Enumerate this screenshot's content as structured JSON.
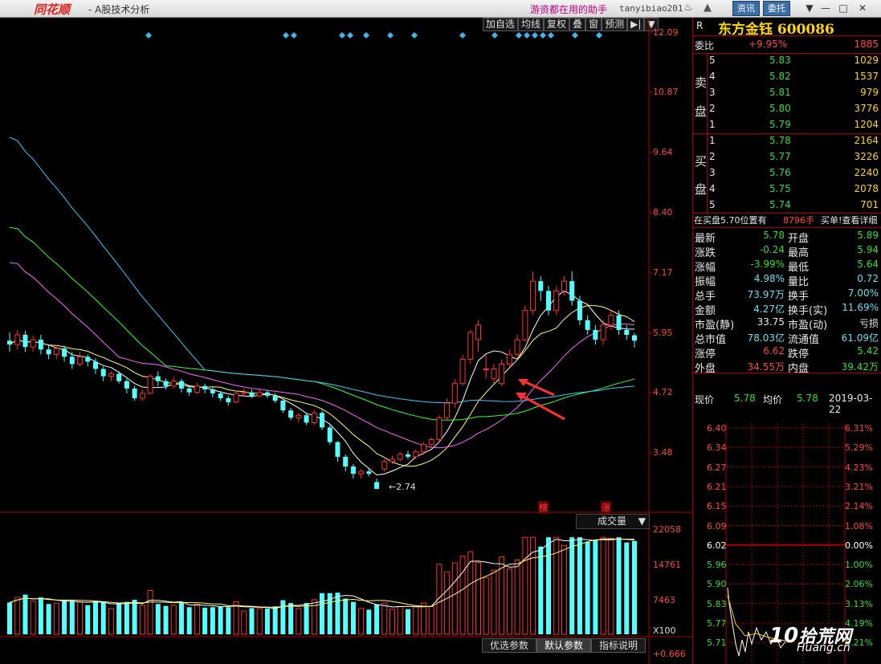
{
  "titlebar": {
    "logo": "同花顺",
    "title": "- A股技术分析",
    "slogan": "游资都在用的助手",
    "user": "tanyibiao201",
    "btn_news": "资讯",
    "btn_order": "委托"
  },
  "toolbar": [
    "加自选",
    "均线",
    "复权",
    "叠",
    "窗",
    "预测"
  ],
  "stock": {
    "r": "R",
    "name": "东方金钰 600086"
  },
  "weibi": {
    "label": "委比",
    "pct": "+9.95%",
    "val": "1885"
  },
  "sell_label": [
    "卖",
    "盘"
  ],
  "buy_label": [
    "买",
    "盘"
  ],
  "sell": [
    {
      "lv": "5",
      "p": "5.83",
      "v": "1029"
    },
    {
      "lv": "4",
      "p": "5.82",
      "v": "1537"
    },
    {
      "lv": "3",
      "p": "5.81",
      "v": "979"
    },
    {
      "lv": "2",
      "p": "5.80",
      "v": "3776"
    },
    {
      "lv": "1",
      "p": "5.79",
      "v": "1204"
    }
  ],
  "buy": [
    {
      "lv": "1",
      "p": "5.78",
      "v": "2164"
    },
    {
      "lv": "2",
      "p": "5.77",
      "v": "3226"
    },
    {
      "lv": "3",
      "p": "5.76",
      "v": "2240"
    },
    {
      "lv": "4",
      "p": "5.75",
      "v": "2078"
    },
    {
      "lv": "5",
      "p": "5.74",
      "v": "701"
    }
  ],
  "maibuy": {
    "a": "在买盘5.70位置有",
    "b": "8796手",
    "c": "买单!查看详细"
  },
  "quote": [
    {
      "l1": "最新",
      "v1": "5.78",
      "c1": "green",
      "l2": "开盘",
      "v2": "5.89",
      "c2": "green"
    },
    {
      "l1": "涨跌",
      "v1": "-0.24",
      "c1": "green",
      "l2": "最高",
      "v2": "5.94",
      "c2": "green"
    },
    {
      "l1": "涨幅",
      "v1": "-3.99%",
      "c1": "green",
      "l2": "最低",
      "v2": "5.64",
      "c2": "green"
    },
    {
      "l1": "振幅",
      "v1": "4.98%",
      "c1": "cyan",
      "l2": "量比",
      "v2": "0.72",
      "c2": "cyan"
    },
    {
      "l1": "总手",
      "v1": "73.97万",
      "c1": "cyan",
      "l2": "换手",
      "v2": "7.00%",
      "c2": "cyan"
    },
    {
      "l1": "金额",
      "v1": "4.27亿",
      "c1": "cyan",
      "l2": "换手(实)",
      "v2": "11.69%",
      "c2": "cyan"
    },
    {
      "l1": "市盈(静)",
      "v1": "33.75",
      "c1": "white",
      "l2": "市盈(动)",
      "v2": "亏损",
      "c2": "white"
    },
    {
      "l1": "总市值",
      "v1": "78.03亿",
      "c1": "cyan",
      "l2": "流通值",
      "v2": "61.09亿",
      "c2": "cyan"
    },
    {
      "l1": "涨停",
      "v1": "6.62",
      "c1": "red",
      "l2": "跌停",
      "v2": "5.42",
      "c2": "green"
    },
    {
      "l1": "外盘",
      "v1": "34.55万",
      "c1": "red",
      "l2": "内盘",
      "v2": "39.42万",
      "c2": "green"
    }
  ],
  "current": {
    "l1": "现价",
    "v1": "5.78",
    "l2": "均价",
    "v2": "5.78",
    "date": "2019-03-22"
  },
  "kline_axis": [
    "12.09",
    "10.87",
    "9.64",
    "8.40",
    "7.17",
    "5.95",
    "4.72",
    "3.48"
  ],
  "low_label": "2.74",
  "tags": {
    "bang": "榜",
    "zhang": "涨"
  },
  "vol": {
    "tag": "成交量",
    "axis": [
      "22058",
      "14761",
      "7463"
    ],
    "unit": "X100"
  },
  "macd_val": "+0.666",
  "bottom_tabs": [
    "优选参数",
    "默认参数",
    "指标说明"
  ],
  "intraday_axis": [
    {
      "p": "6.40",
      "pc": "6.31%"
    },
    {
      "p": "6.34",
      "pc": "5.29%"
    },
    {
      "p": "6.27",
      "pc": "4.23%"
    },
    {
      "p": "6.21",
      "pc": "3.21%"
    },
    {
      "p": "6.15",
      "pc": "2.14%"
    },
    {
      "p": "6.09",
      "pc": "1.08%"
    },
    {
      "p": "6.02",
      "pc": "0.00%"
    },
    {
      "p": "5.96",
      "pc": "1.00%"
    },
    {
      "p": "5.90",
      "pc": "2.06%"
    },
    {
      "p": "5.83",
      "pc": "3.13%"
    },
    {
      "p": "5.77",
      "pc": "4.19%"
    },
    {
      "p": "5.71",
      "pc": "5.21%"
    }
  ],
  "watermark": {
    "a": "10",
    "b": "拾荒网",
    "c": "Huang.cn"
  },
  "chart_data": {
    "type": "candlestick",
    "price_range": [
      2.74,
      12.09
    ],
    "low": 2.74,
    "candles": [
      [
        5.78,
        5.7,
        5.95,
        5.55
      ],
      [
        5.7,
        5.9,
        6.0,
        5.6
      ],
      [
        5.9,
        5.65,
        5.98,
        5.55
      ],
      [
        5.65,
        5.8,
        5.88,
        5.55
      ],
      [
        5.8,
        5.6,
        5.9,
        5.5
      ],
      [
        5.6,
        5.5,
        5.7,
        5.4
      ],
      [
        5.5,
        5.62,
        5.7,
        5.4
      ],
      [
        5.62,
        5.45,
        5.68,
        5.35
      ],
      [
        5.45,
        5.3,
        5.55,
        5.2
      ],
      [
        5.3,
        5.45,
        5.55,
        5.25
      ],
      [
        5.45,
        5.35,
        5.5,
        5.25
      ],
      [
        5.35,
        5.2,
        5.42,
        5.1
      ],
      [
        5.2,
        5.05,
        5.25,
        4.95
      ],
      [
        5.05,
        5.1,
        5.15,
        4.95
      ],
      [
        5.1,
        4.95,
        5.15,
        4.9
      ],
      [
        4.95,
        4.8,
        5.0,
        4.7
      ],
      [
        4.8,
        4.6,
        4.85,
        4.55
      ],
      [
        4.6,
        4.7,
        4.78,
        4.55
      ],
      [
        4.7,
        5.05,
        5.1,
        4.68
      ],
      [
        5.05,
        4.95,
        5.15,
        4.85
      ],
      [
        4.95,
        4.85,
        5.0,
        4.78
      ],
      [
        4.85,
        4.95,
        5.05,
        4.8
      ],
      [
        4.95,
        4.8,
        5.0,
        4.72
      ],
      [
        4.8,
        4.72,
        4.85,
        4.65
      ],
      [
        4.72,
        4.85,
        4.92,
        4.68
      ],
      [
        4.85,
        4.78,
        4.9,
        4.7
      ],
      [
        4.78,
        4.7,
        4.82,
        4.62
      ],
      [
        4.7,
        4.6,
        4.75,
        4.55
      ],
      [
        4.6,
        4.52,
        4.65,
        4.45
      ],
      [
        4.52,
        4.7,
        4.75,
        4.5
      ],
      [
        4.7,
        4.72,
        4.8,
        4.65
      ],
      [
        4.72,
        4.65,
        4.78,
        4.6
      ],
      [
        4.65,
        4.72,
        4.78,
        4.62
      ],
      [
        4.72,
        4.65,
        4.76,
        4.6
      ],
      [
        4.65,
        4.55,
        4.7,
        4.5
      ],
      [
        4.55,
        4.35,
        4.58,
        4.3
      ],
      [
        4.35,
        4.2,
        4.4,
        4.15
      ],
      [
        4.2,
        4.25,
        4.3,
        4.1
      ],
      [
        4.25,
        4.1,
        4.3,
        4.05
      ],
      [
        4.1,
        4.3,
        4.35,
        4.05
      ],
      [
        4.3,
        4.0,
        4.35,
        3.95
      ],
      [
        4.0,
        3.7,
        4.05,
        3.65
      ],
      [
        3.7,
        3.4,
        3.72,
        3.3
      ],
      [
        3.4,
        3.2,
        3.45,
        3.1
      ],
      [
        3.2,
        3.05,
        3.25,
        2.95
      ],
      [
        3.05,
        3.1,
        3.15,
        2.95
      ],
      [
        3.1,
        3.05,
        3.15,
        3.0
      ],
      [
        2.88,
        2.74,
        2.95,
        2.74
      ],
      [
        3.15,
        3.3,
        3.35,
        3.1
      ],
      [
        3.3,
        3.35,
        3.42,
        3.25
      ],
      [
        3.35,
        3.45,
        3.5,
        3.3
      ],
      [
        3.45,
        3.4,
        3.52,
        3.35
      ],
      [
        3.4,
        3.5,
        3.55,
        3.35
      ],
      [
        3.5,
        3.65,
        3.7,
        3.45
      ],
      [
        3.65,
        3.75,
        3.8,
        3.6
      ],
      [
        3.75,
        4.2,
        4.25,
        3.7
      ],
      [
        4.2,
        4.5,
        4.6,
        4.15
      ],
      [
        4.5,
        4.9,
        5.0,
        4.4
      ],
      [
        4.9,
        5.4,
        5.5,
        4.85
      ],
      [
        5.4,
        5.95,
        6.0,
        5.3
      ],
      [
        5.8,
        6.1,
        6.2,
        5.55
      ],
      [
        5.2,
        5.2,
        5.5,
        5.0
      ],
      [
        5.0,
        5.2,
        5.3,
        4.9
      ],
      [
        4.9,
        5.3,
        5.4,
        4.85
      ],
      [
        5.3,
        5.5,
        5.6,
        5.25
      ],
      [
        5.5,
        5.8,
        5.9,
        5.4
      ],
      [
        5.8,
        6.4,
        6.5,
        5.75
      ],
      [
        6.4,
        7.0,
        7.2,
        6.3
      ],
      [
        7.0,
        6.8,
        7.1,
        6.6
      ],
      [
        6.8,
        6.4,
        6.9,
        6.3
      ],
      [
        6.4,
        6.8,
        6.9,
        6.3
      ],
      [
        6.8,
        7.0,
        7.1,
        6.7
      ],
      [
        7.0,
        6.6,
        7.2,
        6.5
      ],
      [
        6.6,
        6.2,
        6.7,
        6.1
      ],
      [
        6.2,
        6.0,
        6.3,
        5.9
      ],
      [
        6.0,
        5.8,
        6.1,
        5.7
      ],
      [
        5.8,
        6.1,
        6.2,
        5.7
      ],
      [
        6.1,
        6.3,
        6.4,
        6.0
      ],
      [
        6.3,
        6.0,
        6.4,
        5.9
      ],
      [
        6.0,
        5.9,
        6.1,
        5.8
      ],
      [
        5.89,
        5.78,
        5.94,
        5.64
      ]
    ]
  }
}
